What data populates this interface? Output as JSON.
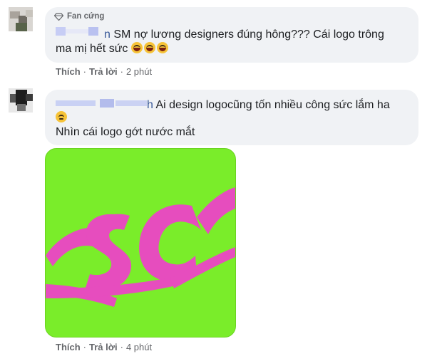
{
  "comments": [
    {
      "badge": "Fan cứng",
      "name_tail": "n",
      "text_line1": "SM nợ lương designers đúng hông??? Cái logo trông",
      "text_line2": "ma mị hết sức",
      "emojis": [
        "laughing-crying-emoji",
        "laughing-crying-emoji",
        "laughing-crying-emoji"
      ],
      "actions": {
        "like": "Thích",
        "reply": "Trả lời",
        "time": "2 phút"
      }
    },
    {
      "name_tail": "h",
      "text_line1": "Ai design logocũng tốn nhiều công sức lắm ha",
      "emoji": "sad-tear-emoji",
      "text_line2": "Nhìn cái logo gớt nước mắt",
      "logo": {
        "letters": "SC",
        "bg_color": "#7aed2a",
        "letter_color": "#e64dbe"
      },
      "actions": {
        "like": "Thích",
        "reply": "Trả lời",
        "time": "4 phút"
      }
    }
  ],
  "colors": {
    "bubble": "#f0f2f5",
    "meta": "#65676b",
    "text": "#1c1e21"
  }
}
